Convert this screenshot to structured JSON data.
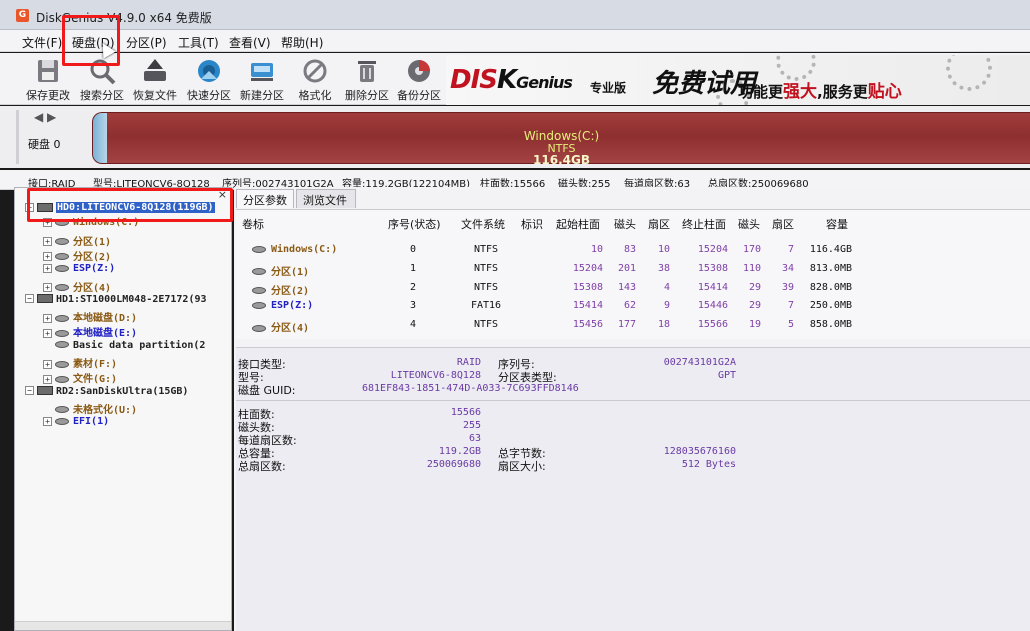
{
  "window": {
    "title": "DiskGenius V4.9.0 x64 免费版",
    "icon": "diskgenius-app-icon"
  },
  "menu": [
    "文件(F)",
    "硬盘(D)",
    "分区(P)",
    "工具(T)",
    "查看(V)",
    "帮助(H)"
  ],
  "toolbar": [
    {
      "label": "保存更改",
      "icon": "save-disk-icon"
    },
    {
      "label": "搜索分区",
      "icon": "search-partition-icon"
    },
    {
      "label": "恢复文件",
      "icon": "recover-files-icon"
    },
    {
      "label": "快速分区",
      "icon": "quick-partition-icon"
    },
    {
      "label": "新建分区",
      "icon": "new-partition-icon"
    },
    {
      "label": "格式化",
      "icon": "format-icon"
    },
    {
      "label": "删除分区",
      "icon": "delete-partition-icon"
    },
    {
      "label": "备份分区",
      "icon": "backup-partition-icon"
    }
  ],
  "banner": {
    "logo_d": "D",
    "logo_i": "I",
    "logo_s": "S",
    "logo_k": "K",
    "logo_genius": "Genius",
    "edition": "专业版",
    "free_trial": "免费试用",
    "slogan_1": "功能更",
    "slogan_2": "强大",
    "slogan_3": ",服务更",
    "slogan_4": "贴心"
  },
  "disk_bar": {
    "label": "硬盘 0"
  },
  "partition_visual": {
    "name": "Windows(C:)",
    "fs": "NTFS",
    "size": "116.4GB"
  },
  "disk_info": {
    "iface": "接口:RAID",
    "model": "型号:LITEONCV6-8Q128",
    "serial": "序列号:002743101G2A",
    "capacity": "容量:119.2GB(122104MB)",
    "cylinders": "柱面数:15566",
    "heads": "磁头数:255",
    "sectors_per_track": "每道扇区数:63",
    "total_sectors": "总扇区数:250069680"
  },
  "tree": [
    {
      "level": 0,
      "expander": "−",
      "kind": "disk",
      "text": "HD0:LITEONCV6-8Q128(119GB)",
      "color": "selected"
    },
    {
      "level": 1,
      "expander": "+",
      "kind": "part",
      "text": "Windows(C:)",
      "color": "brown"
    },
    {
      "level": 1,
      "expander": "+",
      "kind": "part",
      "text": "分区(1)",
      "color": "brown"
    },
    {
      "level": 1,
      "expander": "+",
      "kind": "part",
      "text": "分区(2)",
      "color": "brown"
    },
    {
      "level": 1,
      "expander": "+",
      "kind": "part",
      "text": "ESP(Z:)",
      "color": "blue"
    },
    {
      "level": 1,
      "expander": "+",
      "kind": "part",
      "text": "分区(4)",
      "color": "brown"
    },
    {
      "level": 0,
      "expander": "−",
      "kind": "disk",
      "text": "HD1:ST1000LM048-2E7172(93",
      "color": "dark"
    },
    {
      "level": 1,
      "expander": "+",
      "kind": "part",
      "text": "本地磁盘(D:)",
      "color": "brown"
    },
    {
      "level": 1,
      "expander": "+",
      "kind": "part",
      "text": "本地磁盘(E:)",
      "color": "blue"
    },
    {
      "level": 1,
      "expander": "",
      "kind": "part",
      "text": "Basic data partition(2",
      "color": "dark"
    },
    {
      "level": 1,
      "expander": "+",
      "kind": "part",
      "text": "素材(F:)",
      "color": "brown"
    },
    {
      "level": 1,
      "expander": "+",
      "kind": "part",
      "text": "文件(G:)",
      "color": "brown"
    },
    {
      "level": 0,
      "expander": "−",
      "kind": "disk",
      "text": "RD2:SanDiskUltra(15GB)",
      "color": "dark"
    },
    {
      "level": 1,
      "expander": "",
      "kind": "part",
      "text": "未格式化(U:)",
      "color": "brown"
    },
    {
      "level": 1,
      "expander": "+",
      "kind": "part",
      "text": "EFI(1)",
      "color": "blue"
    }
  ],
  "tabs": [
    "分区参数",
    "浏览文件"
  ],
  "table": {
    "headers": [
      "卷标",
      "序号(状态)",
      "文件系统",
      "标识",
      "起始柱面",
      "磁头",
      "扇区",
      "终止柱面",
      "磁头",
      "扇区",
      "容量"
    ],
    "rows": [
      {
        "name": "Windows(C:)",
        "color": "brown",
        "index": "0",
        "fs": "NTFS",
        "id": "",
        "start_cyl": "10",
        "start_head": "83",
        "start_sec": "10",
        "end_cyl": "15204",
        "end_head": "170",
        "end_sec": "7",
        "capacity": "116.4GB"
      },
      {
        "name": "分区(1)",
        "color": "brown",
        "index": "1",
        "fs": "NTFS",
        "id": "",
        "start_cyl": "15204",
        "start_head": "201",
        "start_sec": "38",
        "end_cyl": "15308",
        "end_head": "110",
        "end_sec": "34",
        "capacity": "813.0MB"
      },
      {
        "name": "分区(2)",
        "color": "brown",
        "index": "2",
        "fs": "NTFS",
        "id": "",
        "start_cyl": "15308",
        "start_head": "143",
        "start_sec": "4",
        "end_cyl": "15414",
        "end_head": "29",
        "end_sec": "39",
        "capacity": "828.0MB"
      },
      {
        "name": "ESP(Z:)",
        "color": "blue",
        "index": "3",
        "fs": "FAT16",
        "id": "",
        "start_cyl": "15414",
        "start_head": "62",
        "start_sec": "9",
        "end_cyl": "15446",
        "end_head": "29",
        "end_sec": "7",
        "capacity": "250.0MB"
      },
      {
        "name": "分区(4)",
        "color": "brown",
        "index": "4",
        "fs": "NTFS",
        "id": "",
        "start_cyl": "15456",
        "start_head": "177",
        "start_sec": "18",
        "end_cyl": "15566",
        "end_head": "19",
        "end_sec": "5",
        "capacity": "858.0MB"
      }
    ]
  },
  "details": {
    "iface_label": "接口类型:",
    "iface_value": "RAID",
    "model_label": "型号:",
    "model_value": "LITEONCV6-8Q128",
    "guid_label": "磁盘 GUID:",
    "guid_value": "681EF843-1851-474D-A033-7C693FFD8146",
    "serial_label": "序列号:",
    "serial_value": "002743101G2A",
    "pt_label": "分区表类型:",
    "pt_value": "GPT",
    "cyl_label": "柱面数:",
    "cyl_value": "15566",
    "heads_label": "磁头数:",
    "heads_value": "255",
    "spt_label": "每道扇区数:",
    "spt_value": "63",
    "cap_label": "总容量:",
    "cap_value": "119.2GB",
    "bytes_label": "总字节数:",
    "bytes_value": "128035676160",
    "ts_label": "总扇区数:",
    "ts_value": "250069680",
    "ss_label": "扇区大小:",
    "ss_value": "512 Bytes"
  },
  "colors": {
    "brown": "#8a5a14",
    "blue": "#2121c4",
    "dark": "#222222",
    "accent_red": "#c1121f",
    "annotation_red": "#f01a1a"
  }
}
